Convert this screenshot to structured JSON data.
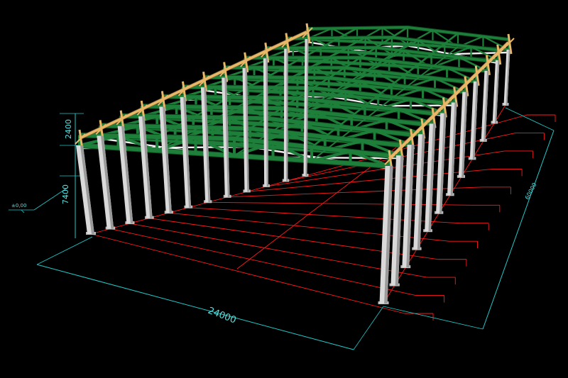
{
  "colors": {
    "background": "#000000",
    "grid": "#ff1a1a",
    "dimension": "#22c9c9",
    "dimension_text": "#55e0e0",
    "truss": "#1e7f3a",
    "truss_outline": "#0e4a1f",
    "purlin": "#e8b868",
    "column": "#d9d9d9",
    "column_shade": "#9a9a9a",
    "bracing": "#f0f0f0"
  },
  "dimensions": {
    "width": "24000",
    "truss_height": "2400",
    "column_height": "7400",
    "base_level": "±0,00",
    "length": "60000"
  },
  "structure": {
    "frame_count": 12,
    "truss_type": "triangulated",
    "view": "isometric"
  }
}
